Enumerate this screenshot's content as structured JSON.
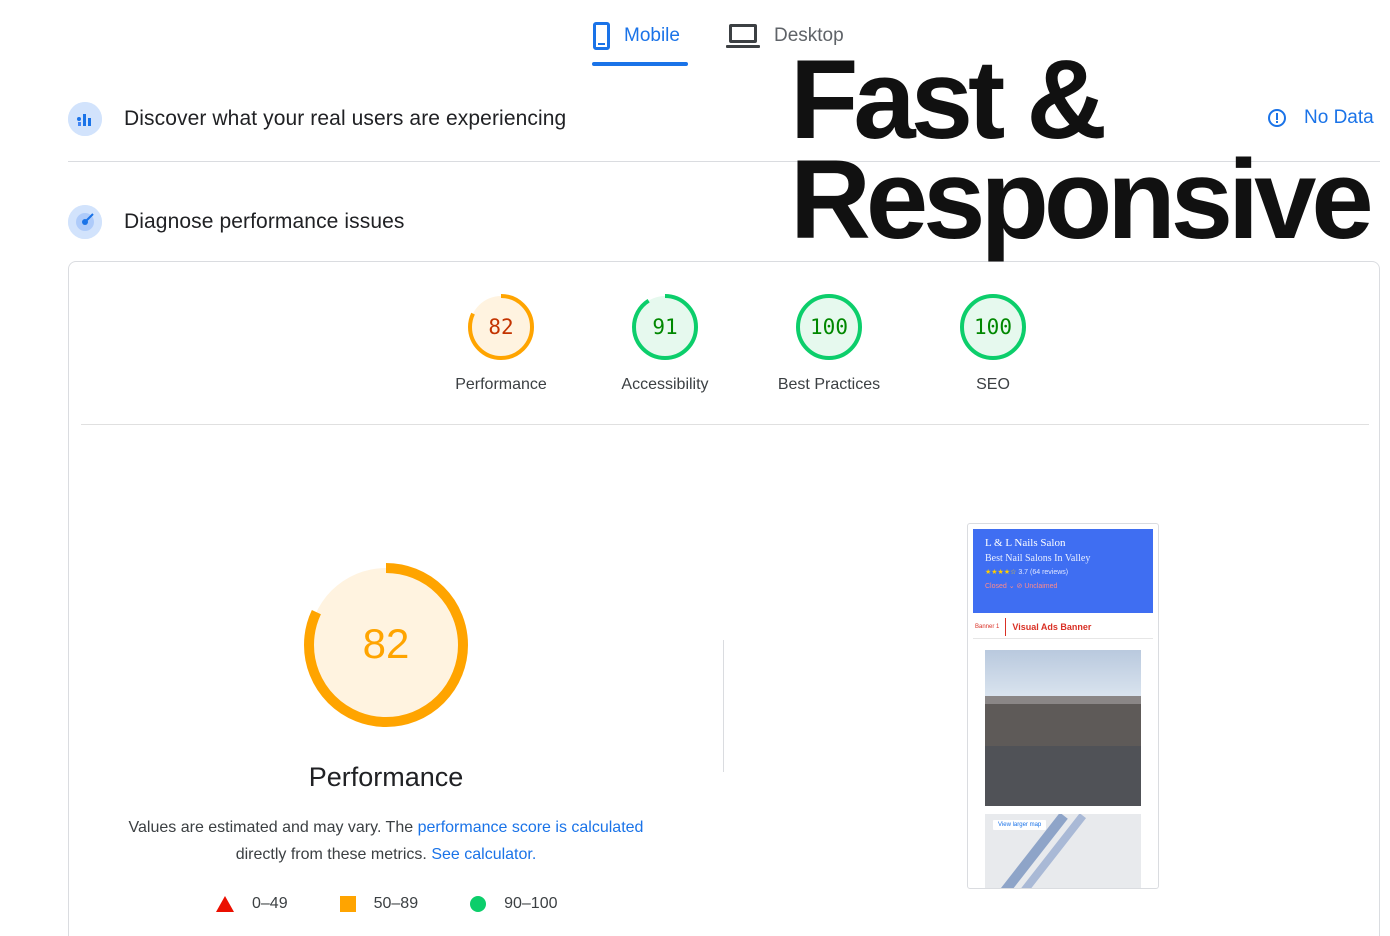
{
  "tabs": {
    "mobile_label": "Mobile",
    "desktop_label": "Desktop"
  },
  "sections": {
    "real_users": "Discover what your real users are experiencing",
    "no_data": "No Data",
    "diagnose": "Diagnose performance issues"
  },
  "headline": {
    "line1": "Fast &",
    "line2": "Responsive"
  },
  "scores": [
    {
      "label": "Performance",
      "value": "82",
      "score": 82,
      "status": "average"
    },
    {
      "label": "Accessibility",
      "value": "91",
      "score": 91,
      "status": "pass"
    },
    {
      "label": "Best Practices",
      "value": "100",
      "score": 100,
      "status": "pass"
    },
    {
      "label": "SEO",
      "value": "100",
      "score": 100,
      "status": "pass"
    }
  ],
  "colors": {
    "average_stroke": "#ffa400",
    "average_text": "#c33300",
    "average_bg": "#fff3e0",
    "pass_stroke": "#0cce6b",
    "pass_text": "#008800",
    "pass_bg": "#e6f9ee",
    "accent": "#1a73e8"
  },
  "main": {
    "score": "82",
    "score_value": 82,
    "title": "Performance",
    "desc_prefix": "Values are estimated and may vary. The ",
    "desc_link1": "performance score is calculated",
    "desc_middle": "directly from these metrics. ",
    "desc_link2": "See calculator."
  },
  "legend": {
    "fail": "0–49",
    "average": "50–89",
    "pass": "90–100"
  },
  "screenshot": {
    "business_name": "L & L Nails Salon",
    "subtitle": "Best Nail Salons In Valley",
    "rating": "3.7 (64 reviews)",
    "status": "Closed ⌄  ⊘ Unclaimed",
    "banner_tag": "Banner 1",
    "banner_title": "Visual Ads Banner",
    "map_button": "View larger map"
  }
}
